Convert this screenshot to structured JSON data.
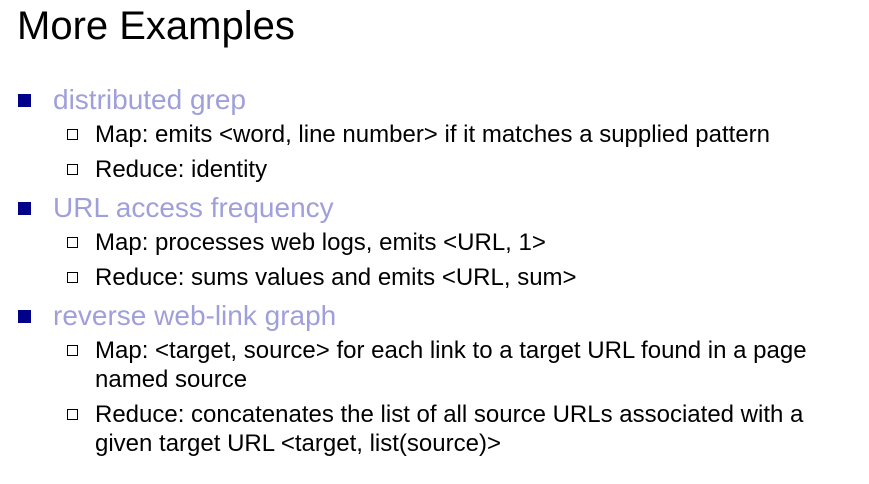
{
  "slide": {
    "title": "More Examples"
  },
  "bullets": [
    {
      "label": "distributed grep",
      "items": [
        "Map: emits <word, line number> if it matches a supplied pattern",
        "Reduce: identity"
      ]
    },
    {
      "label": "URL access frequency",
      "items": [
        "Map: processes web logs, emits <URL, 1>",
        "Reduce: sums values and emits <URL, sum>"
      ]
    },
    {
      "label": "reverse web-link graph",
      "items": [
        "Map: <target, source> for each link to a target URL found in a page named source",
        "Reduce: concatenates the list of all source URLs associated with a given target URL <target, list(source)>"
      ]
    }
  ],
  "colors": {
    "bullet_label": "#9f9fdb",
    "bullet_marker": "#00008b",
    "text": "#000000"
  }
}
